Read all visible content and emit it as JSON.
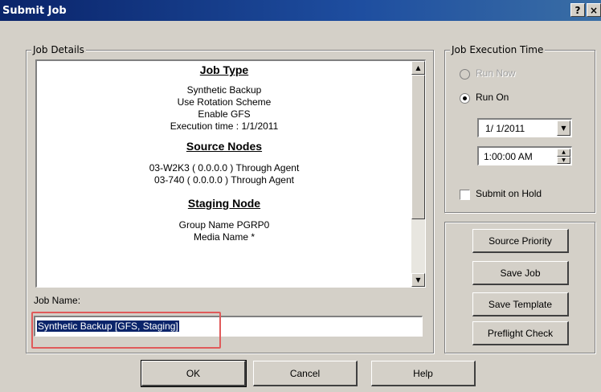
{
  "window": {
    "title": "Submit Job",
    "help_glyph": "?",
    "close_glyph": "×"
  },
  "job_details": {
    "group_label": "Job Details",
    "job_type_heading": "Job Type",
    "job_type_lines": [
      "Synthetic Backup",
      "Use Rotation Scheme",
      "Enable GFS",
      "Execution time :  1/1/2011"
    ],
    "source_nodes_heading": "Source Nodes",
    "source_nodes_lines": [
      "03-W2K3  ( 0.0.0.0 )    Through Agent",
      "03-740 ( 0.0.0.0 )    Through Agent"
    ],
    "staging_node_heading": "Staging Node",
    "staging_node_lines": [
      "Group Name   PGRP0",
      "Media Name   *"
    ]
  },
  "job_name": {
    "label": "Job Name:",
    "value": "Synthetic Backup [GFS, Staging]"
  },
  "execution_time": {
    "group_label": "Job Execution Time",
    "run_now_label": "Run Now",
    "run_on_label": "Run On",
    "selected": "run_on",
    "date_value": "1/ 1/2011",
    "time_value": "1:00:00 AM",
    "submit_on_hold_label": "Submit on Hold",
    "submit_on_hold_checked": false
  },
  "side_buttons": {
    "source_priority": "Source Priority",
    "save_job": "Save Job",
    "save_template": "Save Template",
    "preflight_check": "Preflight Check"
  },
  "bottom_buttons": {
    "ok": "OK",
    "cancel": "Cancel",
    "help": "Help"
  },
  "colors": {
    "titlebar": "#0a246a",
    "dialog_bg": "#d4d0c8",
    "highlight_box": "#e05a5a",
    "selection": "#0a246a"
  }
}
